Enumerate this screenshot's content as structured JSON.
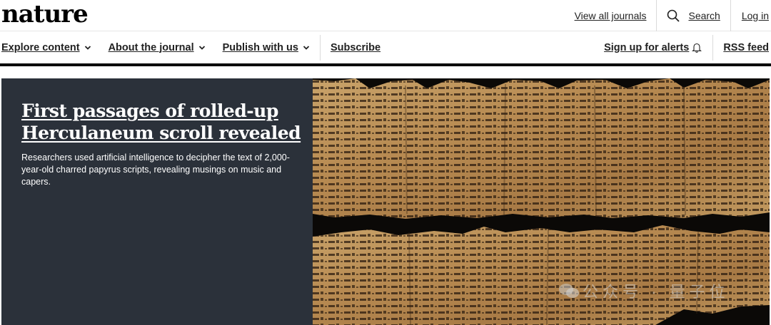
{
  "header": {
    "logo": "nature",
    "view_all_journals": "View all journals",
    "search_label": "Search",
    "login_label": "Log in"
  },
  "nav": {
    "items": [
      {
        "label": "Explore content"
      },
      {
        "label": "About the journal"
      },
      {
        "label": "Publish with us"
      }
    ],
    "subscribe": "Subscribe",
    "alerts": "Sign up for alerts",
    "rss": "RSS feed"
  },
  "hero": {
    "headline": "First passages of rolled-up Herculaneum scroll revealed",
    "standfirst": "Researchers used artificial intelligence to decipher the text of 2,000-year-old charred papyrus scripts, revealing musings on music and capers.",
    "panel_color": "#2b313a"
  },
  "watermark": {
    "text": "公众号 · 量子位"
  },
  "icons": {
    "search": "search-icon",
    "chevron": "chevron-down-icon",
    "bell": "bell-icon"
  }
}
